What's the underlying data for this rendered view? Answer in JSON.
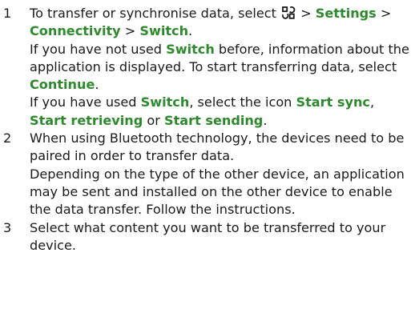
{
  "steps": [
    {
      "num": "1",
      "p1": {
        "t1": "To transfer or synchronise data, select ",
        "icon": "menu-icon",
        "t2": " > ",
        "s1": "Settings",
        "t3": " > ",
        "s2": "Connectivity",
        "t4": " > ",
        "s3": "Switch",
        "t5": "."
      },
      "p2": {
        "t1": "If you have not used ",
        "s1": "Switch",
        "t2": " before, information about the application is displayed. To start transferring data, select ",
        "s2": "Continue",
        "t3": "."
      },
      "p3": {
        "t1": "If you have used ",
        "s1": "Switch",
        "t2": ", select the icon ",
        "s2": "Start sync",
        "t3": ", ",
        "s3": "Start retrieving",
        "t4": " or ",
        "s4": "Start sending",
        "t5": "."
      }
    },
    {
      "num": "2",
      "p1": "When using Bluetooth technology, the devices need to be paired in order to transfer data.",
      "p2": "Depending on the type of the other device, an application may be sent and installed on the other device to enable the data transfer. Follow the instructions."
    },
    {
      "num": "3",
      "p1": "Select what content you want to be transferred to your device."
    }
  ],
  "colors": {
    "keyword": "#2c8a2c",
    "text": "#1a1a1a"
  }
}
